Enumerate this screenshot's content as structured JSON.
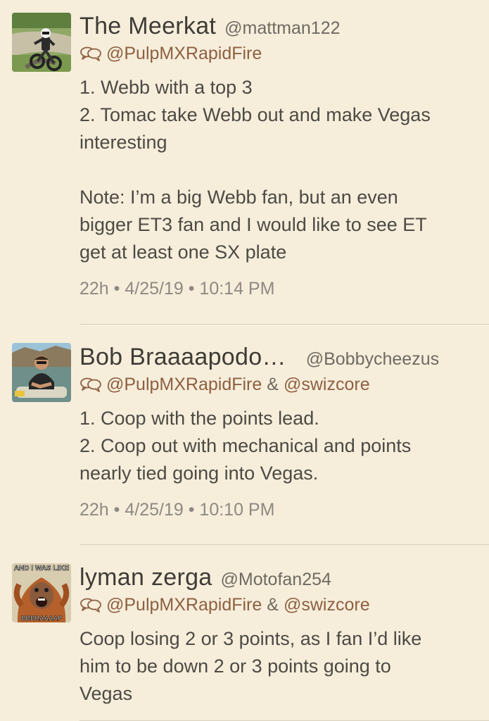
{
  "tweets": [
    {
      "avatar_icon": "motocross-rider-avatar",
      "name": "The Meerkat",
      "handle": "@mattman122",
      "reply_to": [
        "@PulpMXRapidFire"
      ],
      "reply_joiner": "&",
      "reply_icon": "conversation-bubbles-icon",
      "lines": [
        [
          "1. Webb with a top 3",
          "2. Tomac take Webb out and make Vegas",
          "interesting"
        ],
        [
          "Note: I’m a big Webb fan, but an even",
          "bigger ET3 fan and I would like to see ET",
          "get at least one SX plate"
        ]
      ],
      "time": "22h • 4/25/19 • 10:14 PM"
    },
    {
      "avatar_icon": "person-on-boat-avatar",
      "name": "Bob Braaaapodo…",
      "handle": "@Bobbycheezus",
      "reply_to": [
        "@PulpMXRapidFire",
        "@swizcore"
      ],
      "reply_joiner": "&",
      "reply_icon": "conversation-bubbles-icon",
      "lines": [
        [
          "1. Coop with the points lead.",
          "2. Coop out with mechanical and points",
          "nearly tied going into Vegas."
        ]
      ],
      "time": "22h • 4/25/19 • 10:10 PM"
    },
    {
      "avatar_icon": "orangutan-meme-avatar",
      "avatar_top_text": "AND I WAS LIKE",
      "avatar_bottom_text": "BBBRAAAAP",
      "name": "lyman zerga",
      "handle": "@Motofan254",
      "reply_to": [
        "@PulpMXRapidFire",
        "@swizcore"
      ],
      "reply_joiner": "&",
      "reply_icon": "conversation-bubbles-icon",
      "lines": [
        [
          "Coop losing 2 or 3 points, as I fan I’d like",
          "him to be down 2 or 3 points going to",
          "Vegas"
        ]
      ]
    }
  ]
}
